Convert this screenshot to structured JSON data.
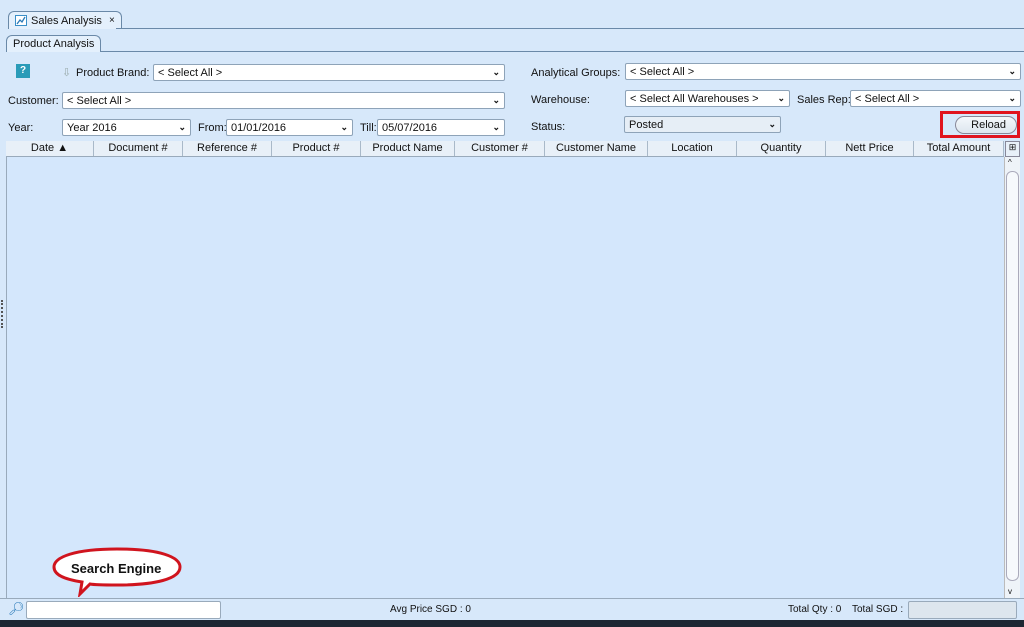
{
  "tabs": {
    "main": "Sales Analysis",
    "sub": "Product Analysis"
  },
  "filters": {
    "product_brand": {
      "label": "Product Brand:",
      "value": "< Select All >"
    },
    "customer": {
      "label": "Customer:",
      "value": "< Select All >"
    },
    "year": {
      "label": "Year:",
      "value": "Year 2016"
    },
    "from": {
      "label": "From:",
      "value": "01/01/2016"
    },
    "till": {
      "label": "Till:",
      "value": "05/07/2016"
    },
    "analytical_groups": {
      "label": "Analytical Groups:",
      "value": "< Select All >"
    },
    "warehouse": {
      "label": "Warehouse:",
      "value": "< Select All Warehouses >"
    },
    "sales_rep": {
      "label": "Sales Rep:",
      "value": "< Select All >"
    },
    "status": {
      "label": "Status:",
      "value": "Posted"
    }
  },
  "reload_label": "Reload",
  "columns": [
    "Date ▲",
    "Document #",
    "Reference #",
    "Product #",
    "Product Name",
    "Customer #",
    "Customer Name",
    "Location",
    "Quantity",
    "Nett Price",
    "Total Amount"
  ],
  "annotation": "Search Engine",
  "footer": {
    "avg_price": "Avg Price SGD : 0",
    "total_qty": "Total Qty : 0",
    "total_sgd": "Total SGD :"
  },
  "colors": {
    "highlight": "#e0141e",
    "background": "#d7e8fa"
  }
}
